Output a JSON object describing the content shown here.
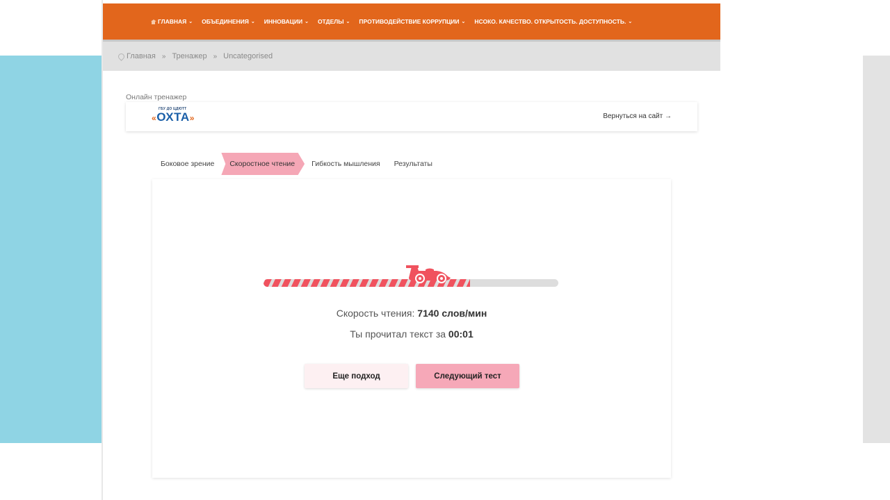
{
  "nav": {
    "items": [
      {
        "label": "ГЛАВНАЯ"
      },
      {
        "label": "ОБЪЕДИНЕНИЯ"
      },
      {
        "label": "ИННОВАЦИИ"
      },
      {
        "label": "ОТДЕЛЫ"
      },
      {
        "label": "ПРОТИВОДЕЙСТВИЕ КОРРУПЦИИ"
      },
      {
        "label": "НСОКО. КАЧЕСТВО. ОТКРЫТОСТЬ. ДОСТУПНОСТЬ."
      }
    ],
    "chevron": "⌄"
  },
  "breadcrumb": {
    "items": [
      "Главная",
      "Тренажер",
      "Uncategorised"
    ],
    "separator": "»"
  },
  "trainer": {
    "label": "Онлайн тренажер",
    "logo_top": "ГБУ ДО ЦДЮТТ",
    "logo_main": "ОХТА",
    "logo_quote_left": "«",
    "logo_quote_right": "»",
    "back_link": "Вернуться на сайт →"
  },
  "tabs": [
    {
      "label": "Боковое зрение",
      "active": false
    },
    {
      "label": "Скоростное чтение",
      "active": true
    },
    {
      "label": "Гибкость мышления",
      "active": false
    },
    {
      "label": "Результаты",
      "active": false
    }
  ],
  "result": {
    "speed_label": "Скорость чтения: ",
    "speed_value": "7140 слов/мин",
    "time_label": "Ты прочитал текст за ",
    "time_value": "00:01",
    "progress": 0.7
  },
  "buttons": {
    "again": "Еще подход",
    "next": "Следующий тест"
  },
  "colors": {
    "nav_bg": "#e2661c",
    "accent_pink": "#f6a8b8",
    "car_red": "#f0525e",
    "left_panel": "#8fd4e4"
  },
  "icons": {
    "home": "home-icon",
    "location": "location-pin-icon",
    "car": "race-car-icon"
  }
}
